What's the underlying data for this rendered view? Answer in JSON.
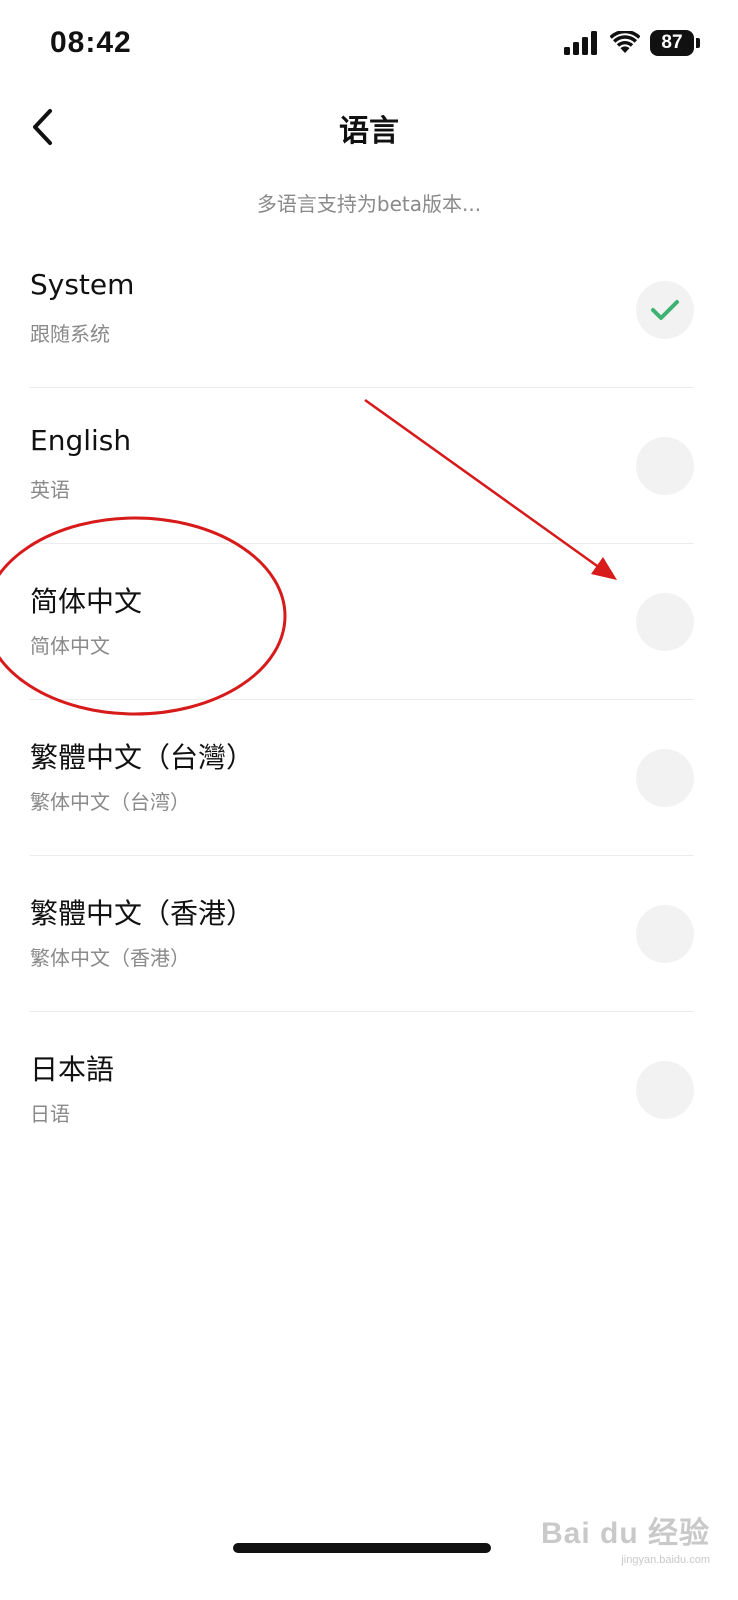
{
  "status_bar": {
    "time": "08:42",
    "battery": "87"
  },
  "nav": {
    "title": "语言"
  },
  "beta_note": "多语言支持为beta版本...",
  "languages": [
    {
      "name": "System",
      "subtitle": "跟随系统",
      "selected": true
    },
    {
      "name": "English",
      "subtitle": "英语",
      "selected": false
    },
    {
      "name": "简体中文",
      "subtitle": "简体中文",
      "selected": false
    },
    {
      "name": "繁體中文（台灣）",
      "subtitle": "繁体中文（台湾）",
      "selected": false
    },
    {
      "name": "繁體中文（香港）",
      "subtitle": "繁体中文（香港）",
      "selected": false
    },
    {
      "name": "日本語",
      "subtitle": "日语",
      "selected": false
    }
  ],
  "colors": {
    "check": "#3cb371",
    "annotation": "#d71a1a"
  },
  "watermark": {
    "main": "Bai du 经验",
    "sub": "jingyan.baidu.com"
  }
}
